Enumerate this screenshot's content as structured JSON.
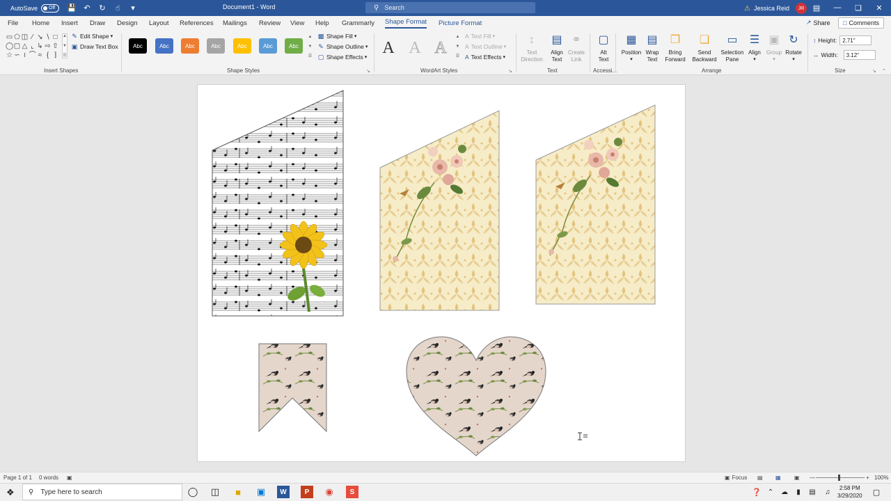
{
  "titlebar": {
    "autosave_label": "AutoSave",
    "autosave_state": "Off",
    "doc_title": "Document1 - Word",
    "search_placeholder": "Search",
    "user_name": "Jessica Reid",
    "user_initials": "JR"
  },
  "tabs": [
    "File",
    "Home",
    "Insert",
    "Draw",
    "Design",
    "Layout",
    "References",
    "Mailings",
    "Review",
    "View",
    "Help",
    "Grammarly",
    "Shape Format",
    "Picture Format"
  ],
  "active_tab": "Shape Format",
  "share_label": "Share",
  "comments_label": "Comments",
  "ribbon": {
    "insert_shapes": {
      "label": "Insert Shapes",
      "edit_shape": "Edit Shape",
      "draw_text_box": "Draw Text Box"
    },
    "shape_styles": {
      "label": "Shape Styles",
      "swatch_text": "Abc",
      "swatches": [
        "#000000",
        "#4472c4",
        "#ed7d31",
        "#a5a5a5",
        "#ffc000",
        "#5b9bd5",
        "#70ad47"
      ],
      "shape_fill": "Shape Fill",
      "shape_outline": "Shape Outline",
      "shape_effects": "Shape Effects"
    },
    "wordart": {
      "label": "WordArt Styles",
      "letter": "A",
      "text_fill": "Text Fill",
      "text_outline": "Text Outline",
      "text_effects": "Text Effects"
    },
    "text_group": {
      "label": "Text",
      "text_direction_1": "Text",
      "text_direction_2": "Direction",
      "align_text_1": "Align",
      "align_text_2": "Text",
      "create_link_1": "Create",
      "create_link_2": "Link"
    },
    "accessibility": {
      "label": "Accessi...",
      "alt_text_1": "Alt",
      "alt_text_2": "Text"
    },
    "arrange": {
      "label": "Arrange",
      "position": "Position",
      "wrap_text_1": "Wrap",
      "wrap_text_2": "Text",
      "bring_forward_1": "Bring",
      "bring_forward_2": "Forward",
      "send_backward_1": "Send",
      "send_backward_2": "Backward",
      "selection_pane_1": "Selection",
      "selection_pane_2": "Pane",
      "align": "Align",
      "group": "Group",
      "rotate": "Rotate"
    },
    "size": {
      "label": "Size",
      "height_label": "Height:",
      "height_value": "2.71\"",
      "width_label": "Width:",
      "width_value": "3.12\""
    }
  },
  "statusbar": {
    "page": "Page 1 of 1",
    "words": "0 words",
    "focus": "Focus",
    "zoom": "100%"
  },
  "taskbar": {
    "search_placeholder": "Type here to search",
    "time": "2:58 PM",
    "date": "3/29/2020"
  },
  "colors": {
    "word_blue": "#2b579a",
    "ribbon_bg": "#f3f3f3",
    "page_bg": "#ffffff",
    "floral_bg": "#f6ecc8",
    "bird_bg": "#e4d6cb"
  }
}
